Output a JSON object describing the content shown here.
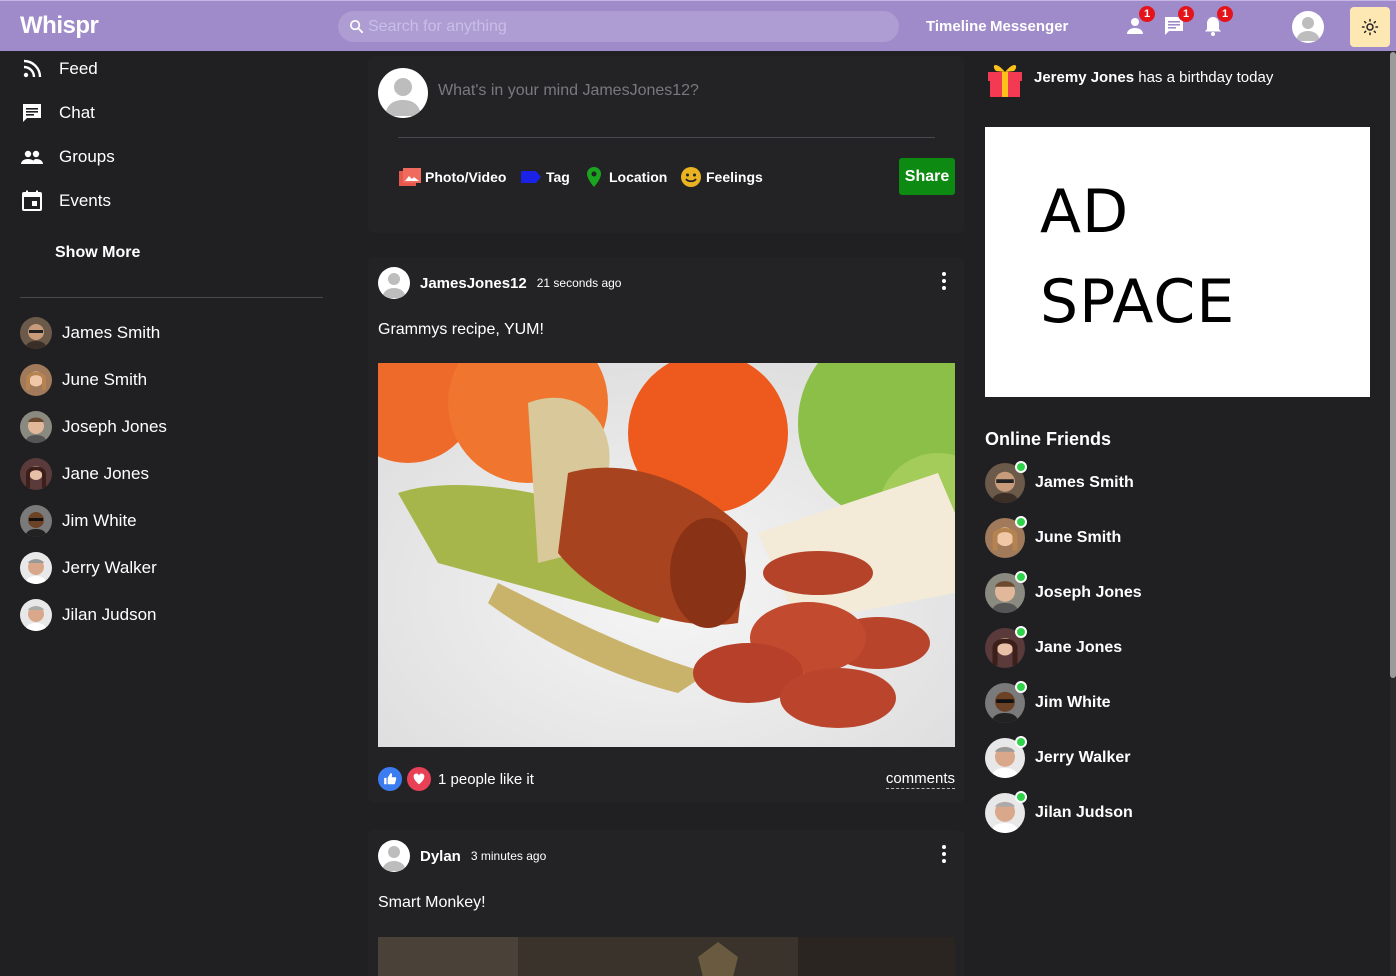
{
  "app": {
    "name": "Whispr"
  },
  "header": {
    "search_placeholder": "Search for anything",
    "links": [
      "Timeline",
      "Messenger"
    ],
    "badges": {
      "friend_requests": "1",
      "messages": "1",
      "notifications": "1"
    },
    "accent_color": "#9f8bc9"
  },
  "sidebar": {
    "nav": [
      {
        "label": "Feed",
        "icon": "rss-icon"
      },
      {
        "label": "Chat",
        "icon": "chat-icon"
      },
      {
        "label": "Groups",
        "icon": "groups-icon"
      },
      {
        "label": "Events",
        "icon": "calendar-icon"
      }
    ],
    "show_more": "Show More",
    "friends": [
      "James Smith",
      "June Smith",
      "Joseph Jones",
      "Jane Jones",
      "Jim White",
      "Jerry Walker",
      "Jilan Judson"
    ]
  },
  "composer": {
    "placeholder": "What's in your mind JamesJones12?",
    "options": [
      "Photo/Video",
      "Tag",
      "Location",
      "Feelings"
    ],
    "share_label": "Share",
    "share_color": "#0d8a12"
  },
  "posts": [
    {
      "user": "JamesJones12",
      "time": "21 seconds ago",
      "text": "Grammys recipe, YUM!",
      "image_alt": "sausage and banana on plate",
      "likes": "1 people like it",
      "comments_label": "comments"
    },
    {
      "user": "Dylan",
      "time": "3 minutes ago",
      "text": "Smart Monkey!"
    }
  ],
  "right": {
    "birthday_name": "Jeremy Jones",
    "birthday_text": " has a birthday today",
    "ad_lines": [
      "AD",
      "SPACE"
    ],
    "online_title": "Online Friends",
    "online_friends": [
      "James Smith",
      "June Smith",
      "Joseph Jones",
      "Jane Jones",
      "Jim White",
      "Jerry Walker",
      "Jilan Judson"
    ]
  }
}
